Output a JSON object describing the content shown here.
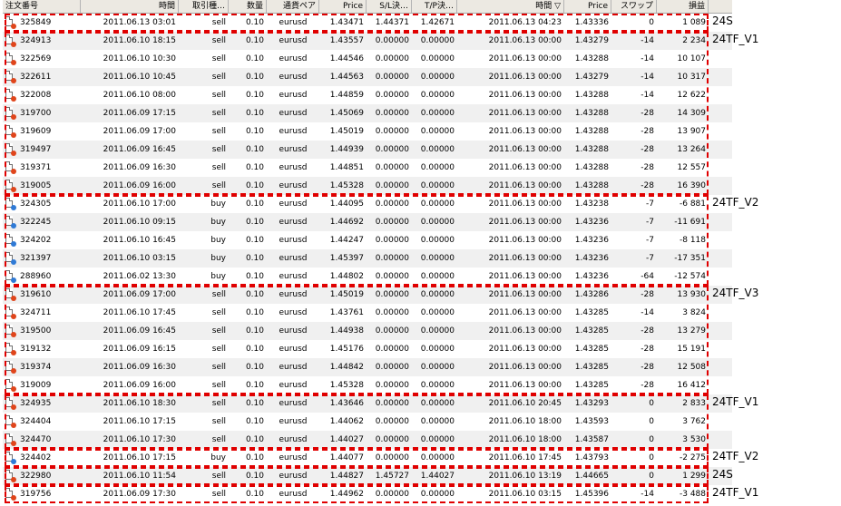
{
  "columns": [
    "注文番号",
    "時間",
    "取引種…",
    "数量",
    "通貨ペア",
    "Price",
    "S/L決…",
    "T/P決…",
    "時間 ▽",
    "Price",
    "スワップ",
    "損益"
  ],
  "rows": [
    [
      "325849",
      "2011.06.13 03:01",
      "sell",
      "0.10",
      "eurusd",
      "1.43471",
      "1.44371",
      "1.42671",
      "2011.06.13 04:23",
      "1.43336",
      "0",
      "1 089"
    ],
    [
      "324913",
      "2011.06.10 18:15",
      "sell",
      "0.10",
      "eurusd",
      "1.43557",
      "0.00000",
      "0.00000",
      "2011.06.13 00:00",
      "1.43279",
      "-14",
      "2 234"
    ],
    [
      "322569",
      "2011.06.10 10:30",
      "sell",
      "0.10",
      "eurusd",
      "1.44546",
      "0.00000",
      "0.00000",
      "2011.06.13 00:00",
      "1.43288",
      "-14",
      "10 107"
    ],
    [
      "322611",
      "2011.06.10 10:45",
      "sell",
      "0.10",
      "eurusd",
      "1.44563",
      "0.00000",
      "0.00000",
      "2011.06.13 00:00",
      "1.43279",
      "-14",
      "10 317"
    ],
    [
      "322008",
      "2011.06.10 08:00",
      "sell",
      "0.10",
      "eurusd",
      "1.44859",
      "0.00000",
      "0.00000",
      "2011.06.13 00:00",
      "1.43288",
      "-14",
      "12 622"
    ],
    [
      "319700",
      "2011.06.09 17:15",
      "sell",
      "0.10",
      "eurusd",
      "1.45069",
      "0.00000",
      "0.00000",
      "2011.06.13 00:00",
      "1.43288",
      "-28",
      "14 309"
    ],
    [
      "319609",
      "2011.06.09 17:00",
      "sell",
      "0.10",
      "eurusd",
      "1.45019",
      "0.00000",
      "0.00000",
      "2011.06.13 00:00",
      "1.43288",
      "-28",
      "13 907"
    ],
    [
      "319497",
      "2011.06.09 16:45",
      "sell",
      "0.10",
      "eurusd",
      "1.44939",
      "0.00000",
      "0.00000",
      "2011.06.13 00:00",
      "1.43288",
      "-28",
      "13 264"
    ],
    [
      "319371",
      "2011.06.09 16:30",
      "sell",
      "0.10",
      "eurusd",
      "1.44851",
      "0.00000",
      "0.00000",
      "2011.06.13 00:00",
      "1.43288",
      "-28",
      "12 557"
    ],
    [
      "319005",
      "2011.06.09 16:00",
      "sell",
      "0.10",
      "eurusd",
      "1.45328",
      "0.00000",
      "0.00000",
      "2011.06.13 00:00",
      "1.43288",
      "-28",
      "16 390"
    ],
    [
      "324305",
      "2011.06.10 17:00",
      "buy",
      "0.10",
      "eurusd",
      "1.44095",
      "0.00000",
      "0.00000",
      "2011.06.13 00:00",
      "1.43238",
      "-7",
      "-6 881"
    ],
    [
      "322245",
      "2011.06.10 09:15",
      "buy",
      "0.10",
      "eurusd",
      "1.44692",
      "0.00000",
      "0.00000",
      "2011.06.13 00:00",
      "1.43236",
      "-7",
      "-11 691"
    ],
    [
      "324202",
      "2011.06.10 16:45",
      "buy",
      "0.10",
      "eurusd",
      "1.44247",
      "0.00000",
      "0.00000",
      "2011.06.13 00:00",
      "1.43236",
      "-7",
      "-8 118"
    ],
    [
      "321397",
      "2011.06.10 03:15",
      "buy",
      "0.10",
      "eurusd",
      "1.45397",
      "0.00000",
      "0.00000",
      "2011.06.13 00:00",
      "1.43236",
      "-7",
      "-17 351"
    ],
    [
      "288960",
      "2011.06.02 13:30",
      "buy",
      "0.10",
      "eurusd",
      "1.44802",
      "0.00000",
      "0.00000",
      "2011.06.13 00:00",
      "1.43236",
      "-64",
      "-12 574"
    ],
    [
      "319610",
      "2011.06.09 17:00",
      "sell",
      "0.10",
      "eurusd",
      "1.45019",
      "0.00000",
      "0.00000",
      "2011.06.13 00:00",
      "1.43286",
      "-28",
      "13 930"
    ],
    [
      "324711",
      "2011.06.10 17:45",
      "sell",
      "0.10",
      "eurusd",
      "1.43761",
      "0.00000",
      "0.00000",
      "2011.06.13 00:00",
      "1.43285",
      "-14",
      "3 824"
    ],
    [
      "319500",
      "2011.06.09 16:45",
      "sell",
      "0.10",
      "eurusd",
      "1.44938",
      "0.00000",
      "0.00000",
      "2011.06.13 00:00",
      "1.43285",
      "-28",
      "13 279"
    ],
    [
      "319132",
      "2011.06.09 16:15",
      "sell",
      "0.10",
      "eurusd",
      "1.45176",
      "0.00000",
      "0.00000",
      "2011.06.13 00:00",
      "1.43285",
      "-28",
      "15 191"
    ],
    [
      "319374",
      "2011.06.09 16:30",
      "sell",
      "0.10",
      "eurusd",
      "1.44842",
      "0.00000",
      "0.00000",
      "2011.06.13 00:00",
      "1.43285",
      "-28",
      "12 508"
    ],
    [
      "319009",
      "2011.06.09 16:00",
      "sell",
      "0.10",
      "eurusd",
      "1.45328",
      "0.00000",
      "0.00000",
      "2011.06.13 00:00",
      "1.43285",
      "-28",
      "16 412"
    ],
    [
      "324935",
      "2011.06.10 18:30",
      "sell",
      "0.10",
      "eurusd",
      "1.43646",
      "0.00000",
      "0.00000",
      "2011.06.10 20:45",
      "1.43293",
      "0",
      "2 833"
    ],
    [
      "324404",
      "2011.06.10 17:15",
      "sell",
      "0.10",
      "eurusd",
      "1.44062",
      "0.00000",
      "0.00000",
      "2011.06.10 18:00",
      "1.43593",
      "0",
      "3 762"
    ],
    [
      "324470",
      "2011.06.10 17:30",
      "sell",
      "0.10",
      "eurusd",
      "1.44027",
      "0.00000",
      "0.00000",
      "2011.06.10 18:00",
      "1.43587",
      "0",
      "3 530"
    ],
    [
      "324402",
      "2011.06.10 17:15",
      "buy",
      "0.10",
      "eurusd",
      "1.44077",
      "0.00000",
      "0.00000",
      "2011.06.10 17:45",
      "1.43793",
      "0",
      "-2 275"
    ],
    [
      "322980",
      "2011.06.10 11:54",
      "sell",
      "0.10",
      "eurusd",
      "1.44827",
      "1.45727",
      "1.44027",
      "2011.06.10 13:19",
      "1.44665",
      "0",
      "1 299"
    ],
    [
      "319756",
      "2011.06.09 17:30",
      "sell",
      "0.10",
      "eurusd",
      "1.44962",
      "0.00000",
      "0.00000",
      "2011.06.10 03:15",
      "1.45396",
      "-14",
      "-3 488"
    ]
  ],
  "groups": [
    {
      "label": "24S",
      "first": 0,
      "last": 0
    },
    {
      "label": "24TF_V1",
      "first": 1,
      "last": 9
    },
    {
      "label": "24TF_V2",
      "first": 10,
      "last": 14
    },
    {
      "label": "24TF_V3",
      "first": 15,
      "last": 20
    },
    {
      "label": "24TF_V1",
      "first": 21,
      "last": 23
    },
    {
      "label": "24TF_V2",
      "first": 24,
      "last": 24
    },
    {
      "label": "24S",
      "first": 25,
      "last": 25
    },
    {
      "label": "24TF_V1",
      "first": 26,
      "last": 26
    }
  ],
  "colors": {
    "sell": "#e0451b",
    "buy": "#2f7ad6",
    "annotation": "#e00000"
  }
}
